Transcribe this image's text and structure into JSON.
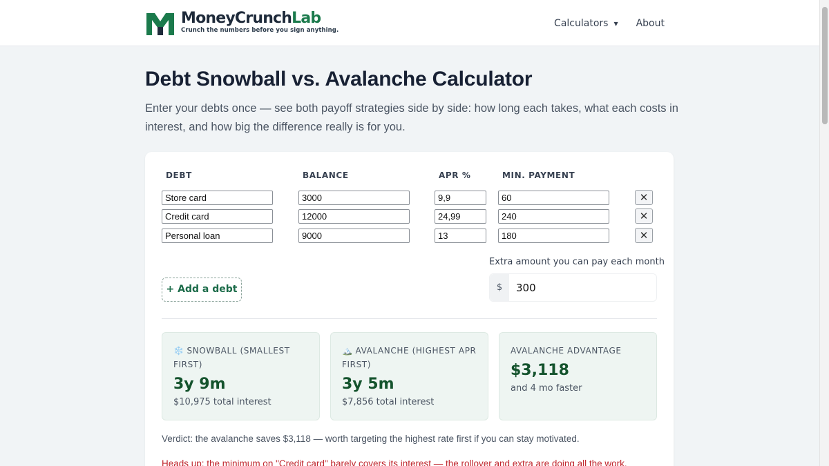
{
  "header": {
    "brand_part1": "MoneyCrunch",
    "brand_part2": "Lab",
    "tagline": "Crunch the numbers before you sign anything.",
    "nav": {
      "calculators": "Calculators",
      "calculators_caret": "▼",
      "about": "About"
    }
  },
  "page": {
    "title": "Debt Snowball vs. Avalanche Calculator",
    "intro": "Enter your debts once — see both payoff strategies side by side: how long each takes, what each costs in interest, and how big the difference really is for you."
  },
  "table": {
    "headers": {
      "debt": "DEBT",
      "balance": "BALANCE",
      "apr": "APR %",
      "min_payment": "MIN. PAYMENT"
    },
    "rows": [
      {
        "debt": "Store card",
        "balance": "3000",
        "apr": "9,9",
        "min_payment": "60",
        "delete": "✕"
      },
      {
        "debt": "Credit card",
        "balance": "12000",
        "apr": "24,99",
        "min_payment": "240",
        "delete": "✕"
      },
      {
        "debt": "Personal loan",
        "balance": "9000",
        "apr": "13",
        "min_payment": "180",
        "delete": "✕"
      }
    ]
  },
  "extra": {
    "label": "Extra amount you can pay each month",
    "prefix": "$",
    "value": "300"
  },
  "add_debt_label": "+ Add a debt",
  "results": {
    "snowball": {
      "icon": "❄️",
      "label": "SNOWBALL (SMALLEST FIRST)",
      "value": "3y 9m",
      "sub": "$10,975 total interest"
    },
    "avalanche": {
      "icon": "🏔️",
      "label": "AVALANCHE (HIGHEST APR FIRST)",
      "value": "3y 5m",
      "sub": "$7,856 total interest"
    },
    "advantage": {
      "label": "AVALANCHE ADVANTAGE",
      "value": "$3,118",
      "sub": "and 4 mo faster"
    }
  },
  "verdict": "Verdict: the avalanche saves $3,118 — worth targeting the highest rate first if you can stay motivated.",
  "warning": "Heads up: the minimum on \"Credit card\" barely covers its interest — the rollover and extra are doing all the work.",
  "colors": {
    "brand_green": "#1b7a4c",
    "value_green": "#14532d",
    "warning_red": "#c0262d",
    "result_bg": "#eef5f2"
  }
}
